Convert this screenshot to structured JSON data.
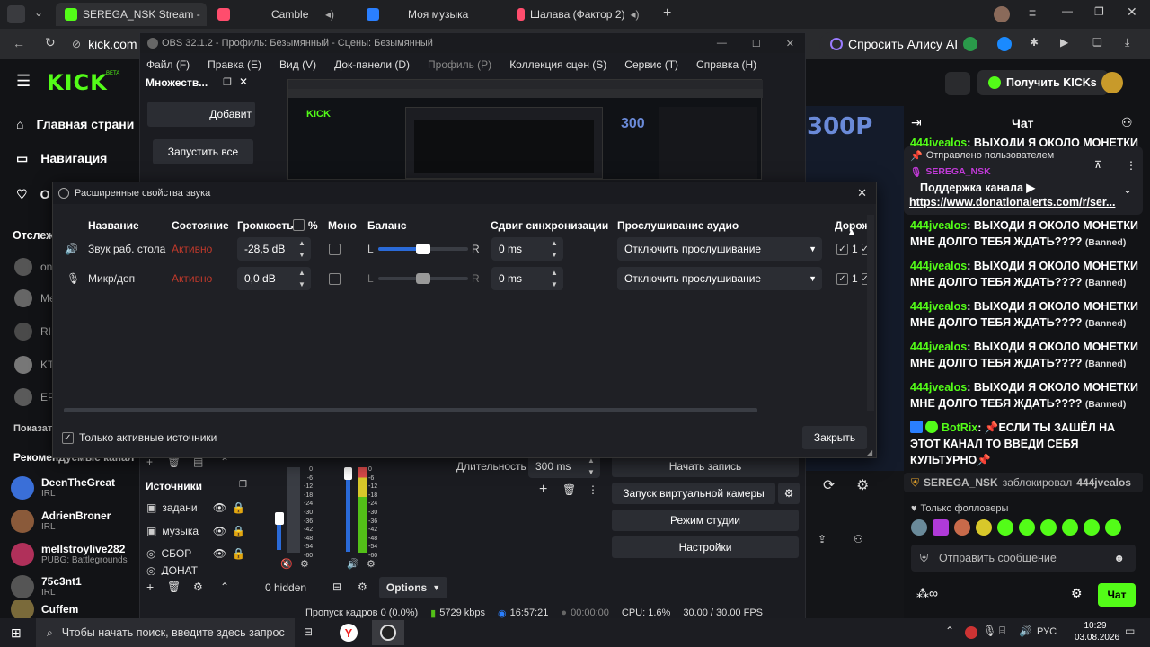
{
  "browser": {
    "tabs": [
      {
        "label": "SEREGA_NSK Stream -",
        "color": "#53fc18"
      },
      {
        "label": "Cambl e",
        "color": "#ff4d6d"
      },
      {
        "label": "Моя музыка",
        "color": "#2a7fff"
      },
      {
        "label": "Шалава (Фактор 2)",
        "color": "#ff4d6d"
      }
    ],
    "url": "kick.com",
    "alice_label": "Спросить Алису AI"
  },
  "kick": {
    "logo": "KICK",
    "beta": "BETA",
    "get_kicks": "Получить KICKs",
    "stream_overlay": "300P",
    "nav": [
      {
        "label": "Главная страни"
      },
      {
        "label": "Навигация"
      },
      {
        "label": "О"
      }
    ],
    "followed_label": "Отслеж",
    "followed_rows": [
      "on",
      "Me",
      "RIL",
      "KT",
      "EP"
    ],
    "show_label": "Показать",
    "recommended_label": "Рекомендуемые канал",
    "recommended": [
      {
        "name": "DeenTheGreat",
        "sub": "IRL",
        "color": "#3a6fd8"
      },
      {
        "name": "AdrienBroner",
        "sub": "IRL",
        "color": "#8a5a3a"
      },
      {
        "name": "mellstroylive282",
        "sub": "PUBG: Battlegrounds",
        "color": "#b0305a"
      },
      {
        "name": "75c3nt1",
        "sub": "IRL",
        "color": "#555"
      },
      {
        "name": "Cuffem",
        "sub": "",
        "color": "#7a6a3a"
      }
    ]
  },
  "obs": {
    "title": "OBS 32.1.2 - Профиль: Безымянный - Сцены: Безымянный",
    "menu": [
      "Файл (F)",
      "Правка (E)",
      "Вид (V)",
      "Док-панели (D)",
      "Профиль (P)",
      "Коллекция сцен (S)",
      "Сервис (T)",
      "Справка (H)"
    ],
    "multiview_title": "Множеств...",
    "add_btn": "Добавит",
    "start_all": "Запустить все",
    "sources_title": "Источники",
    "sources": [
      "задани",
      "музыка",
      "СБОР",
      "ДОНАТ"
    ],
    "duration_label": "Длительность",
    "duration_value": "300 ms",
    "controls": [
      "Начать запись",
      "Запуск виртуальной камеры",
      "Режим студии",
      "Настройки"
    ],
    "hidden_label": "0 hidden",
    "options_label": "Options",
    "status": {
      "dropped": "Пропуск кадров 0 (0.0%)",
      "kbps": "5729 kbps",
      "stream_time": "16:57:21",
      "rec_time": "00:00:00",
      "cpu": "CPU: 1.6%",
      "fps": "30.00 / 30.00 FPS"
    }
  },
  "dialog": {
    "title": "Расширенные свойства звука",
    "headers": {
      "name": "Название",
      "state": "Состояние",
      "volume": "Громкость",
      "percent": "%",
      "mono": "Моно",
      "balance": "Баланс",
      "sync": "Сдвиг синхронизации",
      "monitor": "Прослушивание аудио",
      "tracks": "Дорож"
    },
    "rows": [
      {
        "name": "Звук раб. стола",
        "state": "Активно",
        "volume": "-28,5 dB",
        "sync": "0 ms",
        "monitor": "Отключить прослушивание",
        "track": "1",
        "balance": 0.5
      },
      {
        "name": "Микр/доп",
        "state": "Активно",
        "volume": "0,0 dB",
        "sync": "0 ms",
        "monitor": "Отключить прослушивание",
        "track": "1",
        "balance": 0.5
      }
    ],
    "balance_l": "L",
    "balance_r": "R",
    "only_active": "Только активные источники",
    "close": "Закрыть"
  },
  "chat": {
    "title": "Чат",
    "pinned_by": "Отправлено пользователем",
    "pinned_user": "SEREGA_NSK",
    "pinned_text": "Поддержка канала ▶",
    "pinned_link": "https://www.donationalerts.com/r/ser...",
    "partial_top": "444jvealos: ВЫХОДИ Я ОКОЛО МОНЕТКИ",
    "messages": [
      {
        "user": "444jvealos",
        "text": "ВЫХОДИ Я ОКОЛО МОНЕТКИ МНЕ ДОЛГО ТЕБЯ ЖДАТЬ????",
        "tag": "(Banned)"
      },
      {
        "user": "444jvealos",
        "text": "ВЫХОДИ Я ОКОЛО МОНЕТКИ МНЕ ДОЛГО ТЕБЯ ЖДАТЬ????",
        "tag": "(Banned)"
      },
      {
        "user": "444jvealos",
        "text": "ВЫХОДИ Я ОКОЛО МОНЕТКИ МНЕ ДОЛГО ТЕБЯ ЖДАТЬ????",
        "tag": "(Banned)"
      },
      {
        "user": "444jvealos",
        "text": "ВЫХОДИ Я ОКОЛО МОНЕТКИ МНЕ ДОЛГО ТЕБЯ ЖДАТЬ????",
        "tag": "(Banned)"
      },
      {
        "user": "444jvealos",
        "text": "ВЫХОДИ Я ОКОЛО МОНЕТКИ МНЕ ДОЛГО ТЕБЯ ЖДАТЬ????",
        "tag": "(Banned)"
      }
    ],
    "bot_user": "BotRix",
    "bot_text": "ЕСЛИ ТЫ ЗАШЁЛ НА ЭТОТ КАНАЛ ТО ВВЕДИ СЕБЯ КУЛЬТУРНО",
    "blocked_user": "SEREGA_NSK",
    "blocked_text": "заблокировал",
    "blocked_target": "444jvealos",
    "followers_only": "Только фолловеры",
    "send_placeholder": "Отправить сообщение",
    "chat_button": "Чат"
  },
  "taskbar": {
    "search": "Чтобы начать поиск, введите здесь запрос",
    "lang": "РУС",
    "time": "10:29",
    "date": "03.08.2026"
  }
}
